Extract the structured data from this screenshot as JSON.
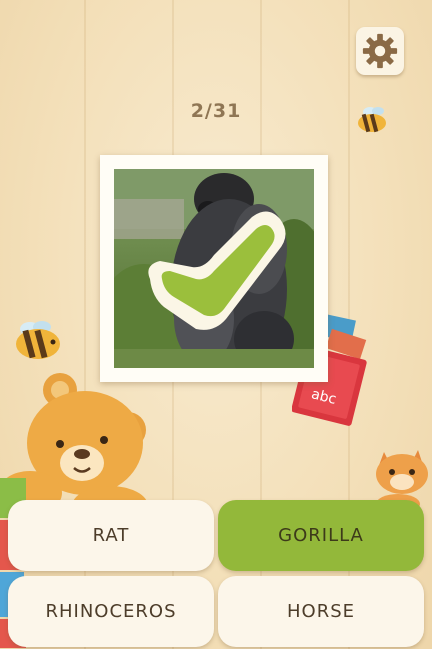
{
  "progress": {
    "text": "2/31"
  },
  "question": {
    "photo_icon": "gorilla-photo",
    "feedback_icon": "check-mark-icon",
    "feedback_color": "#9bbf3c"
  },
  "answers": [
    {
      "label": "RAT",
      "state": "normal"
    },
    {
      "label": "GORILLA",
      "state": "correct"
    },
    {
      "label": "RHINOCEROS",
      "state": "normal"
    },
    {
      "label": "HORSE",
      "state": "normal"
    }
  ],
  "decorations": {
    "book_text": "abc"
  },
  "colors": {
    "accent_green": "#93b83a",
    "text_brown": "#8f7654",
    "card_bg": "#fcf6ea"
  }
}
